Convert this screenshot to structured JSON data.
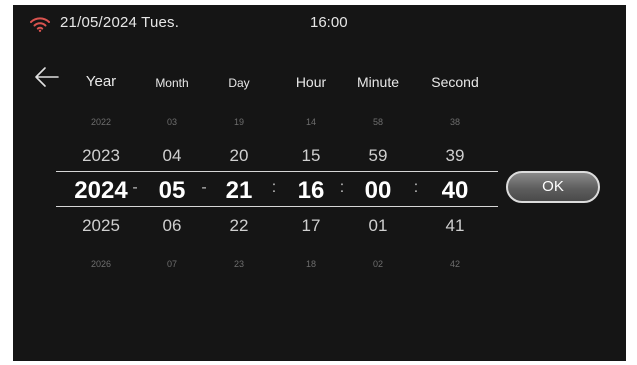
{
  "status": {
    "date": "21/05/2024 Tues.",
    "time": "16:00",
    "wifi_icon": "wifi-icon",
    "wifi_color": "#d9534f"
  },
  "nav": {
    "back_icon": "arrow-left-icon"
  },
  "columns": [
    {
      "header": "Year",
      "values": [
        "2022",
        "2023",
        "2024",
        "2025",
        "2026"
      ]
    },
    {
      "header": "Month",
      "values": [
        "03",
        "04",
        "05",
        "06",
        "07"
      ]
    },
    {
      "header": "Day",
      "values": [
        "19",
        "20",
        "21",
        "22",
        "23"
      ]
    },
    {
      "header": "Hour",
      "values": [
        "14",
        "15",
        "16",
        "17",
        "18"
      ]
    },
    {
      "header": "Minute",
      "values": [
        "58",
        "59",
        "00",
        "01",
        "02"
      ]
    },
    {
      "header": "Second",
      "values": [
        "38",
        "39",
        "40",
        "41",
        "42"
      ]
    }
  ],
  "separators": [
    "-",
    "-",
    ":",
    ":",
    ":"
  ],
  "ok_button": {
    "label": "OK"
  }
}
